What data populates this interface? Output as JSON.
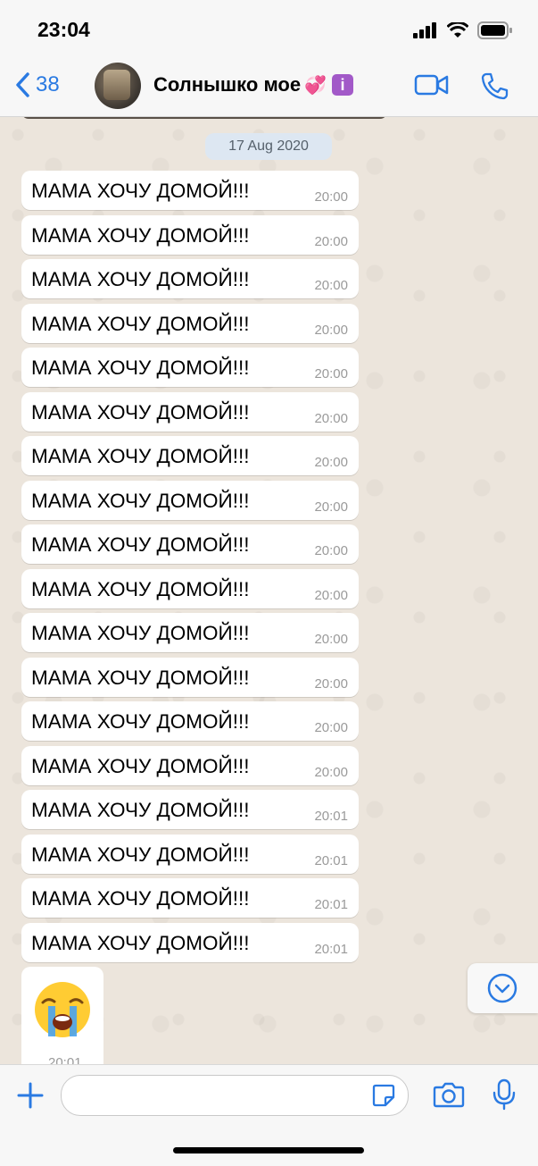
{
  "status": {
    "time": "23:04"
  },
  "header": {
    "back_count": "38",
    "contact_name": "Солнышко мое",
    "name_emoji": "💞",
    "info_badge": "i"
  },
  "chat": {
    "date": "17 Aug 2020",
    "messages": [
      {
        "text": "МАМА ХОЧУ ДОМОЙ!!!",
        "time": "20:00"
      },
      {
        "text": "МАМА ХОЧУ ДОМОЙ!!!",
        "time": "20:00"
      },
      {
        "text": "МАМА ХОЧУ ДОМОЙ!!!",
        "time": "20:00"
      },
      {
        "text": "МАМА ХОЧУ ДОМОЙ!!!",
        "time": "20:00"
      },
      {
        "text": "МАМА ХОЧУ ДОМОЙ!!!",
        "time": "20:00"
      },
      {
        "text": "МАМА ХОЧУ ДОМОЙ!!!",
        "time": "20:00"
      },
      {
        "text": "МАМА ХОЧУ ДОМОЙ!!!",
        "time": "20:00"
      },
      {
        "text": "МАМА ХОЧУ ДОМОЙ!!!",
        "time": "20:00"
      },
      {
        "text": "МАМА ХОЧУ ДОМОЙ!!!",
        "time": "20:00"
      },
      {
        "text": "МАМА ХОЧУ ДОМОЙ!!!",
        "time": "20:00"
      },
      {
        "text": "МАМА ХОЧУ ДОМОЙ!!!",
        "time": "20:00"
      },
      {
        "text": "МАМА ХОЧУ ДОМОЙ!!!",
        "time": "20:00"
      },
      {
        "text": "МАМА ХОЧУ ДОМОЙ!!!",
        "time": "20:00"
      },
      {
        "text": "МАМА ХОЧУ ДОМОЙ!!!",
        "time": "20:00"
      },
      {
        "text": "МАМА ХОЧУ ДОМОЙ!!!",
        "time": "20:01"
      },
      {
        "text": "МАМА ХОЧУ ДОМОЙ!!!",
        "time": "20:01"
      },
      {
        "text": "МАМА ХОЧУ ДОМОЙ!!!",
        "time": "20:01"
      },
      {
        "text": "МАМА ХОЧУ ДОМОЙ!!!",
        "time": "20:01"
      }
    ],
    "emoji_message": {
      "emoji": "loudly-crying-face",
      "time": "20:01"
    }
  },
  "input": {
    "value": "",
    "placeholder": ""
  },
  "colors": {
    "accent": "#2a7ae2",
    "bubble": "#ffffff",
    "date_pill": "#dde7f2"
  },
  "icons": [
    "back-chevron-icon",
    "video-call-icon",
    "phone-icon",
    "plus-icon",
    "sticker-icon",
    "camera-icon",
    "microphone-icon",
    "chevron-down-icon"
  ]
}
